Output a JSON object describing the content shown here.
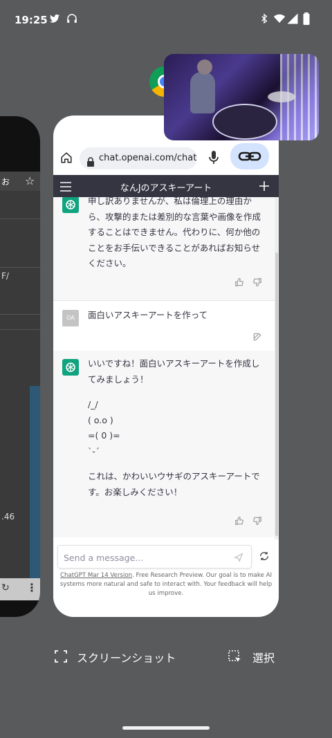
{
  "status_bar": {
    "time": "19:25"
  },
  "browser": {
    "url": "chat.openai.com/chat"
  },
  "chat_app": {
    "title": "なんJのアスキーアート",
    "messages": [
      {
        "role": "assistant",
        "lines": [
          "申し訳ありませんが、私は倫理上の理由から、攻撃的または差別的な言葉や画像を作成することはできません。代わりに、何か他のことをお手伝いできることがあればお知らせください。"
        ]
      },
      {
        "role": "user",
        "avatar": "OA",
        "text": "面白いアスキーアートを作って"
      },
      {
        "role": "assistant",
        "intro": "いいですね！面白いアスキーアートを作成してみましょう！",
        "ascii": [
          "/_/",
          "( o.o )",
          "=( 0 )=",
          "`-´"
        ],
        "outro": "これは、かわいいウサギのアスキーアートです。お楽しみください！"
      }
    ],
    "input_placeholder": "Send a message...",
    "footer_version": "ChatGPT Mar 14 Version",
    "footer_text": ". Free Research Preview. Our goal is to make AI systems more natural and safe to interact with. Your feedback will help us improve."
  },
  "left_card": {
    "bar_text": "お",
    "side_text_1": "F/",
    "side_text_2": ".46"
  },
  "bottom_actions": {
    "screenshot": "スクリーンショット",
    "select": "選択"
  },
  "icons": [
    "twitter-icon",
    "headphones-icon",
    "bluetooth-icon",
    "wifi-icon",
    "signal-icon",
    "battery-icon",
    "chrome-icon",
    "home-icon",
    "lock-icon",
    "mic-icon",
    "link-icon",
    "menu-icon",
    "plus-icon",
    "openai-icon",
    "thumbs-up-icon",
    "thumbs-down-icon",
    "edit-icon",
    "send-icon",
    "regenerate-icon",
    "screenshot-icon",
    "select-icon"
  ]
}
